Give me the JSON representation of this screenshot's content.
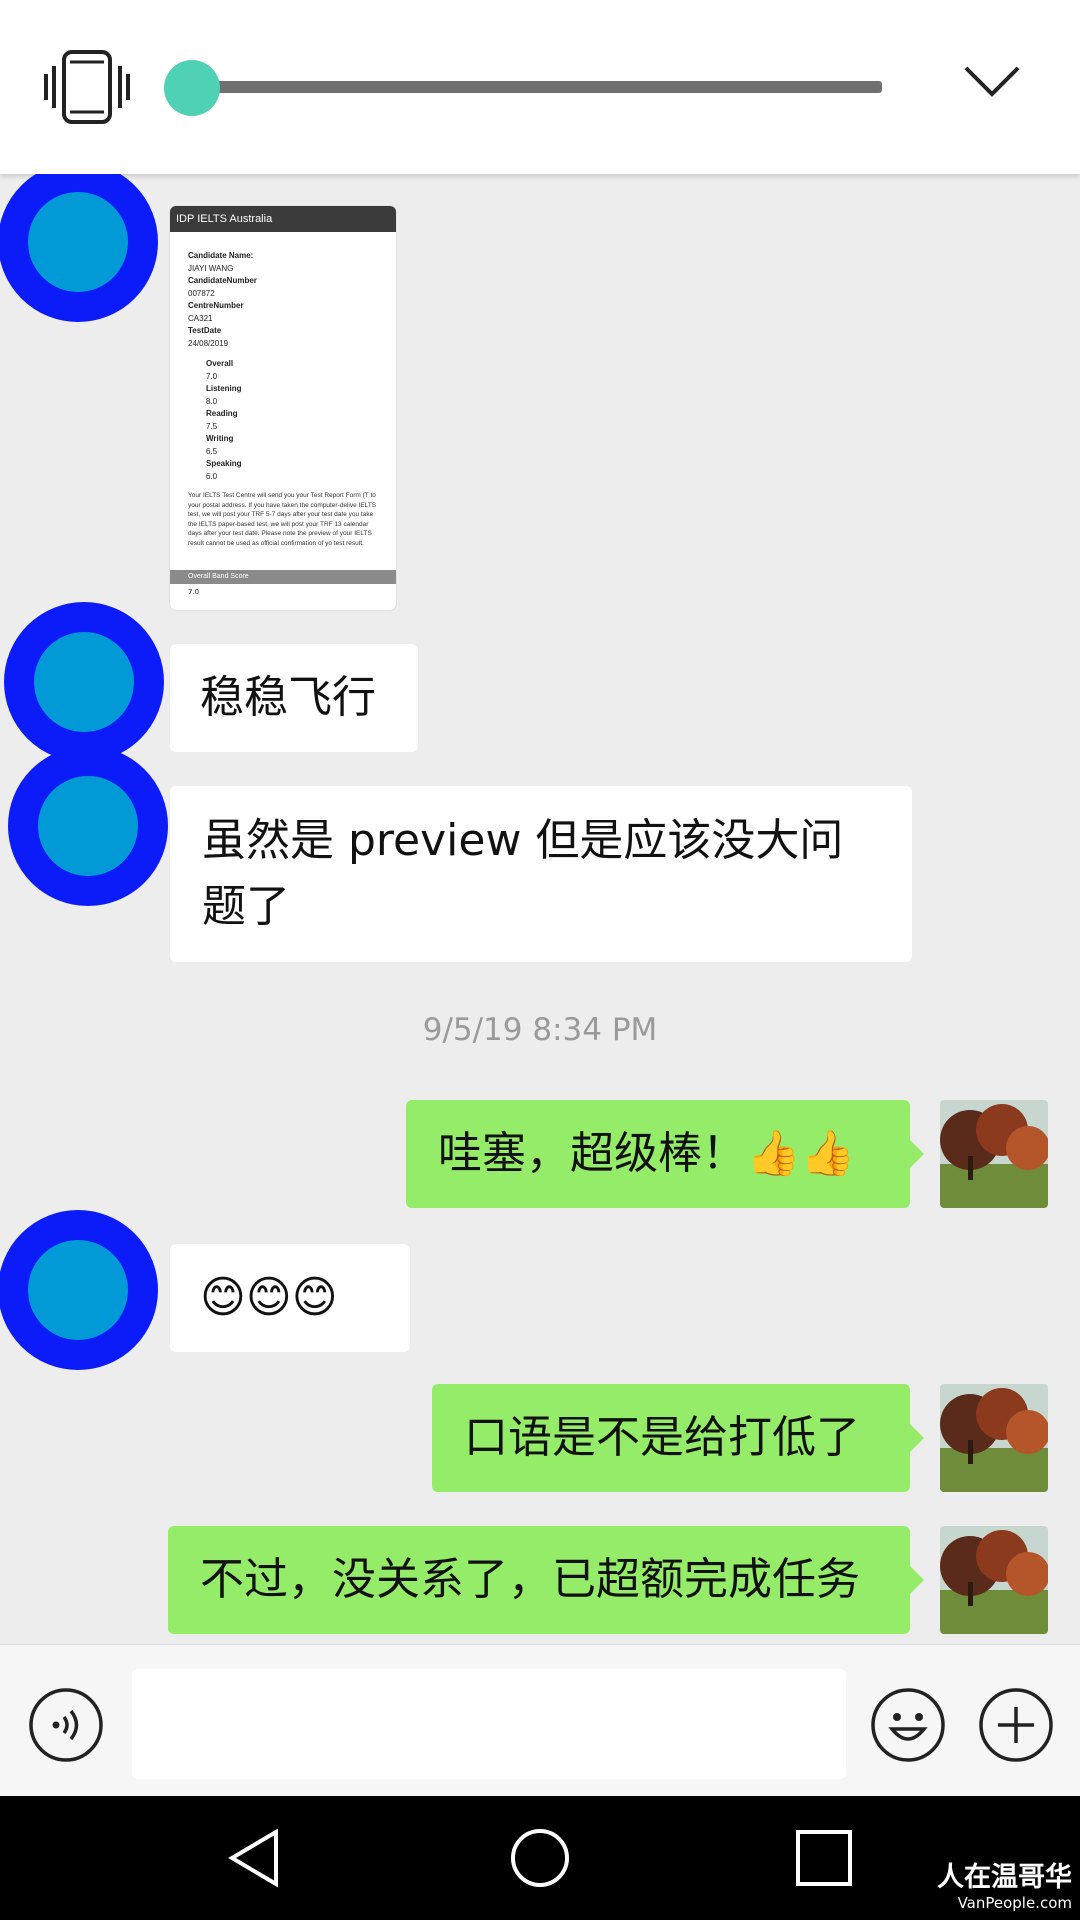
{
  "topbar": {
    "icons": [
      "vibrate-icon",
      "chevron-down-icon"
    ],
    "accent": "#4fd1b5"
  },
  "report": {
    "header": "IDP IELTS Australia",
    "candidate_name_label": "Candidate Name:",
    "candidate_name": "JIAYI WANG",
    "candidate_number_label": "CandidateNumber",
    "candidate_number": "007872",
    "centre_number_label": "CentreNumber",
    "centre_number": "CA321",
    "test_date_label": "TestDate",
    "test_date": "24/08/2019",
    "overall_label": "Overall",
    "overall": "7.0",
    "listening_label": "Listening",
    "listening": "8.0",
    "reading_label": "Reading",
    "reading": "7.5",
    "writing_label": "Writing",
    "writing": "6.5",
    "speaking_label": "Speaking",
    "speaking": "6.0",
    "note": "Your IELTS Test Centre will send you your Test Report Form (T to your postal address. If you have taken the computer-delive IELTS test, we will post your TRF 5-7 days after your test date you take the IELTS paper-based test, we will post your TRF 13 calendar days after your test date. Please note the preview of your IELTS result cannot be used as official confirmation of yo test result.",
    "band_label": "Overall Band Score",
    "band_value": "7.0"
  },
  "messages": {
    "m1": "稳稳飞行",
    "m2": "虽然是 preview 但是应该没大问题了",
    "timestamp": "9/5/19 8:34 PM",
    "m3": "哇塞，超级棒！👍👍",
    "m4": "😊😊😊",
    "m5": "口语是不是给打低了",
    "m6": "不过，没关系了，已超额完成任务"
  },
  "colors": {
    "sent_bubble": "#95ec69",
    "received_bubble": "#ffffff",
    "avatar_ring": "#0b1cf8",
    "avatar_fill": "#0299d7"
  },
  "input_bar": {
    "icons": [
      "voice-icon",
      "emoji-icon",
      "plus-icon"
    ],
    "value": ""
  },
  "navbar": {
    "icons": [
      "back-icon",
      "home-icon",
      "recents-icon"
    ]
  },
  "watermark": {
    "cn": "人在温哥华",
    "en": "VanPeople.com"
  }
}
